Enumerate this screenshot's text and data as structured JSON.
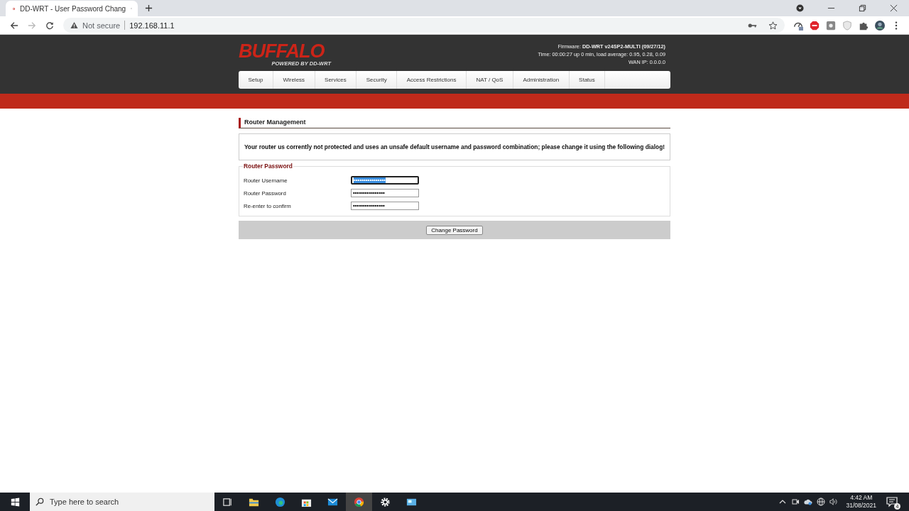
{
  "browser": {
    "tab_title": "DD-WRT - User Password Chang",
    "security": "Not secure",
    "url": "192.168.11.1"
  },
  "header": {
    "logo": "BUFFALO",
    "logo_sub": "POWERED BY DD-WRT",
    "firmware_label": "Firmware:",
    "firmware": "DD-WRT v24SP2-MULTI (09/27/12)",
    "time": "Time: 00:00:27 up 0 min, load average: 0.95, 0.28, 0.09",
    "wan": "WAN IP: 0.0.0.0"
  },
  "menu": [
    {
      "label": "Setup",
      "selected": false
    },
    {
      "label": "Wireless",
      "selected": false
    },
    {
      "label": "Services",
      "selected": false
    },
    {
      "label": "Security",
      "selected": false
    },
    {
      "label": "Access Restrictions",
      "selected": false
    },
    {
      "label": "NAT / QoS",
      "selected": false
    },
    {
      "label": "Administration",
      "selected": false
    },
    {
      "label": "Status",
      "selected": false
    }
  ],
  "section_title": "Router Management",
  "warning": "Your router us corrently not protected and uses an unsafe default username and password combination; please change it using the following dialog!",
  "fieldset": {
    "legend": "Router Password",
    "fields": [
      {
        "label": "Router Username",
        "value": "••••••••••••••••",
        "focused": true
      },
      {
        "label": "Router Password",
        "value": "••••••••••••••••",
        "focused": false
      },
      {
        "label": "Re-enter to confirm",
        "value": "••••••••••••••••",
        "focused": false
      }
    ]
  },
  "button": "Change Password",
  "taskbar": {
    "search_placeholder": "Type here to search",
    "time": "4:42 AM",
    "date": "31/08/2021",
    "notifications": "4"
  }
}
